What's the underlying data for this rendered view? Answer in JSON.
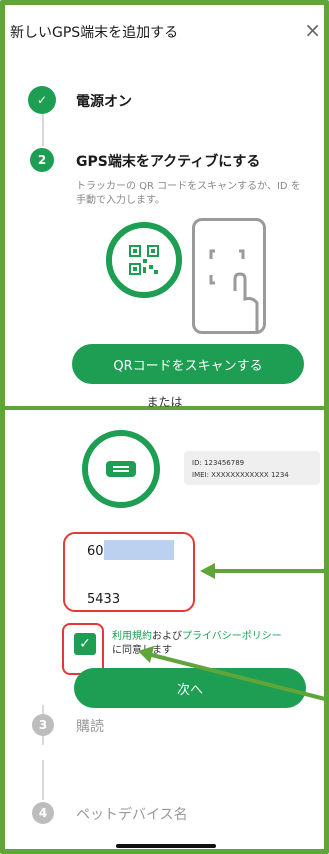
{
  "dialog": {
    "title": "新しいGPS端末を追加する",
    "close_glyph": "×"
  },
  "steps": [
    {
      "number": "✓",
      "label": "電源オン"
    },
    {
      "number": "2",
      "label": "GPS端末をアクティブにする"
    },
    {
      "number": "3",
      "label": "購読"
    },
    {
      "number": "4",
      "label": "ペットデバイス名"
    }
  ],
  "activation": {
    "description": "トラッカーの QR コードをスキャンするか、ID を手動で入力します。",
    "scan_button": "QRコードをスキャンする",
    "or_text": "または",
    "id_label": "ID:  123456789",
    "imei_label": "IMEI:  XXXXXXXXXXXX 1234",
    "field1_value": "60",
    "field2_value": "5433",
    "terms_prefix": "利用規約",
    "terms_and": "および",
    "privacy_link": "プライバシーポリシー",
    "terms_suffix": "に同意します",
    "next_button": "次へ"
  },
  "colors": {
    "accent": "#1d9e52",
    "annotation": "#5fa53a",
    "highlight": "#e53935"
  }
}
